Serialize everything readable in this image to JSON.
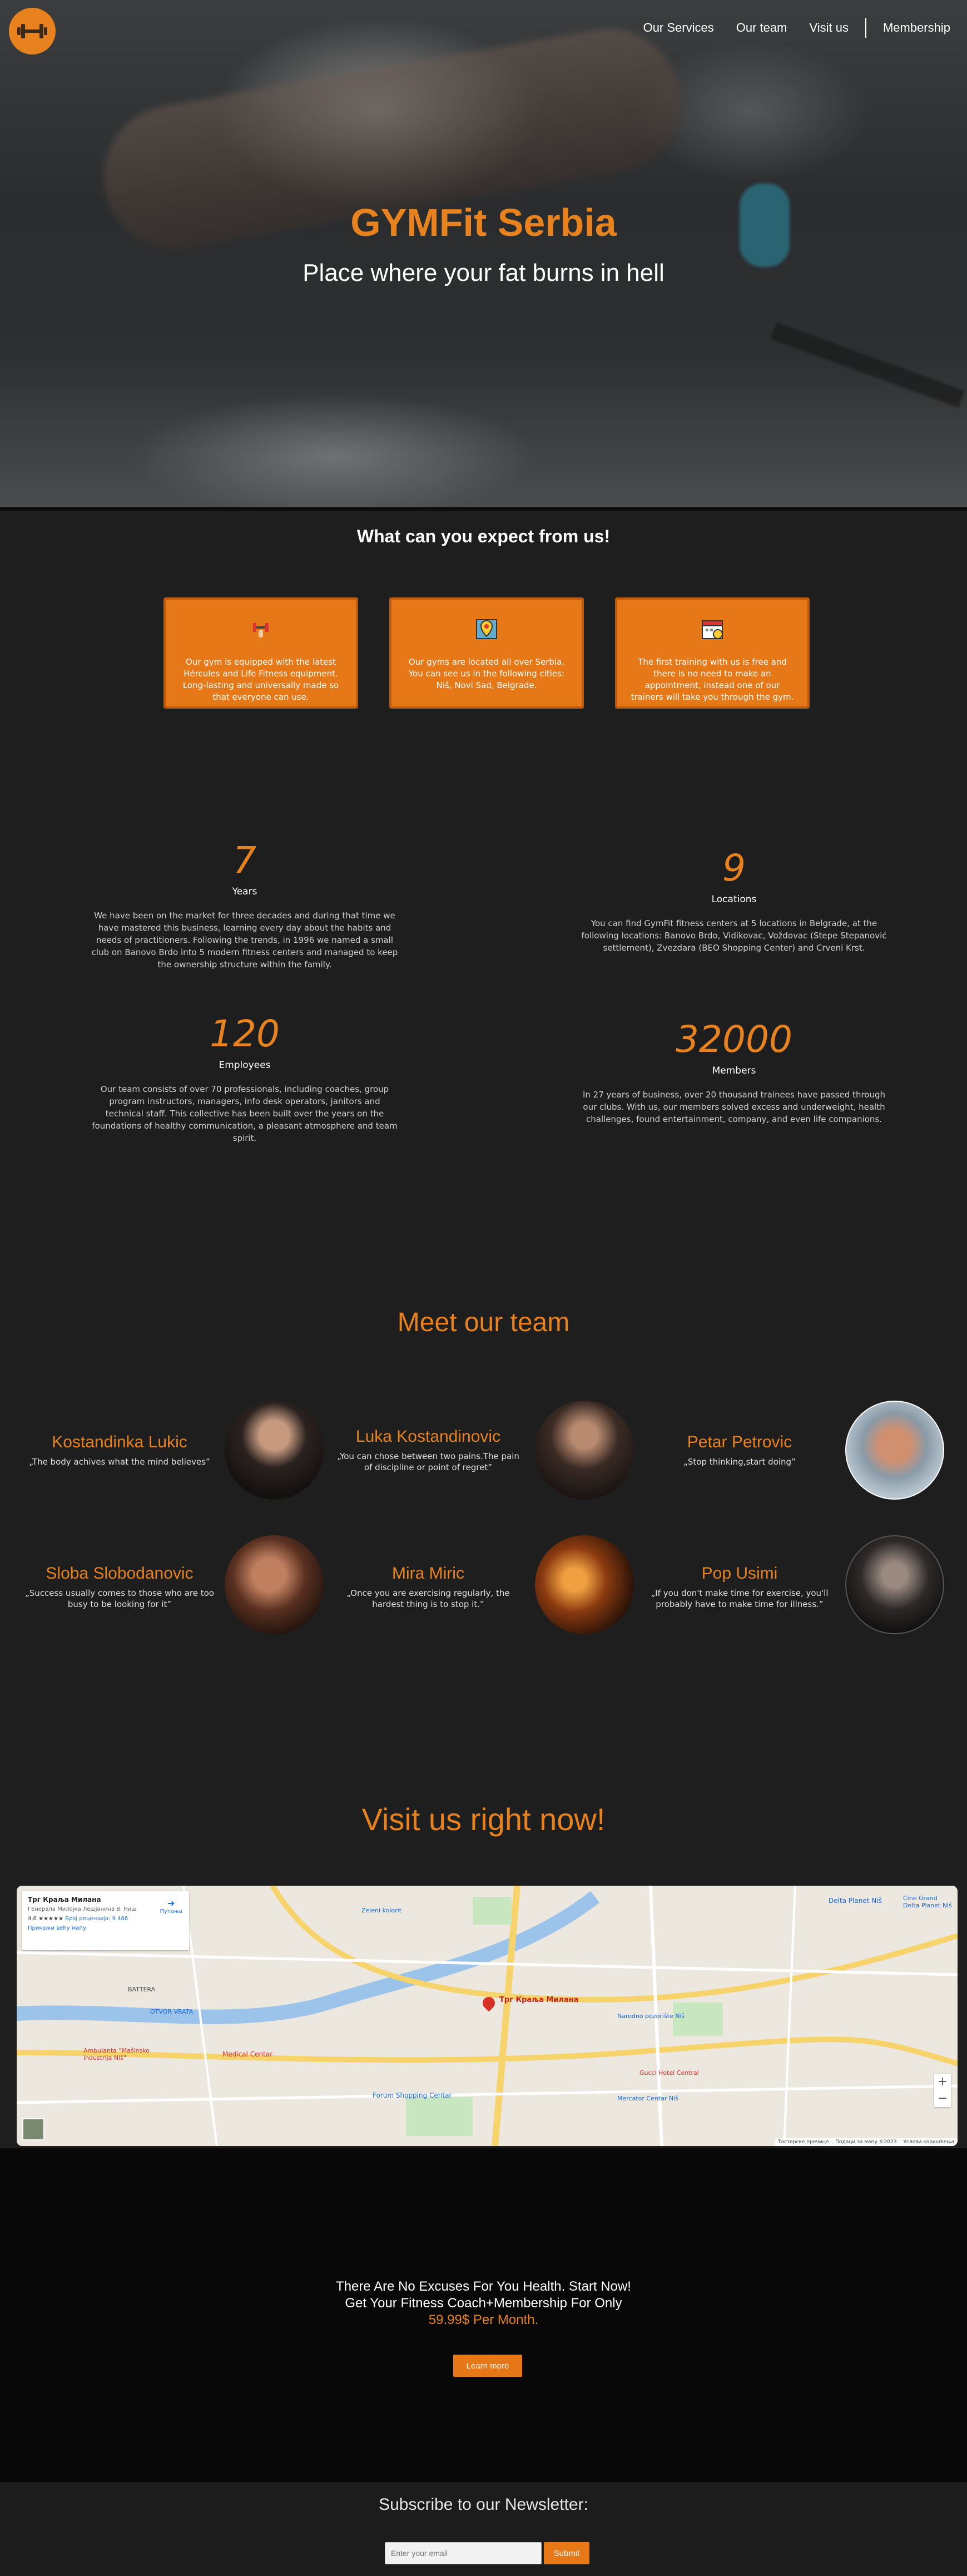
{
  "nav": {
    "logo_icon": "dumbbell-icon",
    "items": [
      "Our Services",
      "Our team",
      "Visit us",
      "Membership"
    ]
  },
  "hero": {
    "title": "GYMFit Serbia",
    "subtitle": "Place where your fat burns in hell"
  },
  "expect": {
    "title": "What can you expect from us!",
    "cards": [
      {
        "icon": "dumbbell-icon",
        "text": "Our gym is equipped with the latest Hércules and Life Fitness equipment. Long-lasting and universally made so that everyone can use."
      },
      {
        "icon": "map-pin-icon",
        "text": "Our gyms are located all over Serbia. You can see us in the following cities: Niš, Novi Sad, Belgrade."
      },
      {
        "icon": "calendar-icon",
        "text": "The first training with us is free and there is no need to make an appointment, instead one of our trainers will take you through the gym."
      }
    ]
  },
  "stats": [
    {
      "number": "7",
      "label": "Years",
      "desc": "We have been on the market for three decades and during that time we have mastered this business, learning every day about the habits and needs of practitioners. Following the trends, in 1996 we named a small club on Banovo Brdo into 5 modern fitness centers and managed to keep the ownership structure within the family."
    },
    {
      "number": "9",
      "label": "Locations",
      "desc": "You can find GymFit fitness centers at 5 locations in Belgrade, at the following locations: Banovo Brdo, Vidikovac, Voždovac (Stepe Stepanović settlement), Zvezdara (BEO Shopping Center) and Crveni Krst."
    },
    {
      "number": "120",
      "label": "Employees",
      "desc": "Our team consists of over 70 professionals, including coaches, group program instructors, managers, info desk operators, janitors and technical staff. This collective has been built over the years on the foundations of healthy communication, a pleasant atmosphere and team spirit."
    },
    {
      "number": "32000",
      "label": "Members",
      "desc": "In 27 years of business, over 20 thousand trainees have passed through our clubs. With us, our members solved excess and underweight, health challenges, found entertainment, company, and even life companions."
    }
  ],
  "team": {
    "title": "Meet our team",
    "members": [
      {
        "name": "Kostandinka Lukic",
        "quote": "„The body achives what the mind believes”"
      },
      {
        "name": "Luka Kostandinovic",
        "quote": "„You can chose between two pains.The pain of discipline or point of regret”"
      },
      {
        "name": "Petar Petrovic",
        "quote": "„Stop thinking,start doing”"
      },
      {
        "name": "Sloba Slobodanovic",
        "quote": "„Success usually comes to those who are too busy to be looking for it”"
      },
      {
        "name": "Mira Miric",
        "quote": "„Once you are exercising regularly, the hardest thing is to stop it.”"
      },
      {
        "name": "Pop Usimi",
        "quote": "„If you don't make time for exercise, you'll probably have to make time for illness.”"
      }
    ]
  },
  "visit": {
    "title": "Visit us right now!",
    "map": {
      "place": "Трг Краља Милана",
      "address": "Генерала Милојка Лешјанина 8, Ниш",
      "rating": "4,6",
      "reviews": "Број рецензија: 9 486",
      "directions": "Путања",
      "larger_map": "Прикажи већу мапу",
      "pin_label": "Трг Краља Милана",
      "footer": [
        "Тастерске пречице",
        "Подаци за мапу ©2023",
        "Услови коришћења"
      ],
      "labels": [
        "Delta Planet Niš",
        "Cine Grand Delta Planet Niš",
        "Zeleni kolorit",
        "Medical Centar",
        "Forum Shopping Centar",
        "Narodno pozorište Niš",
        "Gucci Hotel Central",
        "Mercator Centar Niš",
        "BATTERA",
        "OTVOR VRATA",
        "Ambulanta \"Mašinsko industrija Niš\""
      ]
    }
  },
  "cta": {
    "line1": "There Are No Excuses For You Health. Start Now!",
    "line2": "Get Your Fitness Coach+Membership For Only",
    "price": "59.99$ Per Month.",
    "button": "Learn more"
  },
  "newsletter": {
    "title": "Subscribe to our Newsletter:",
    "placeholder": "Enter your email",
    "button": "Submit"
  },
  "colors": {
    "accent": "#e8821e",
    "card": "#e67818",
    "bg": "#1e1e1e"
  }
}
